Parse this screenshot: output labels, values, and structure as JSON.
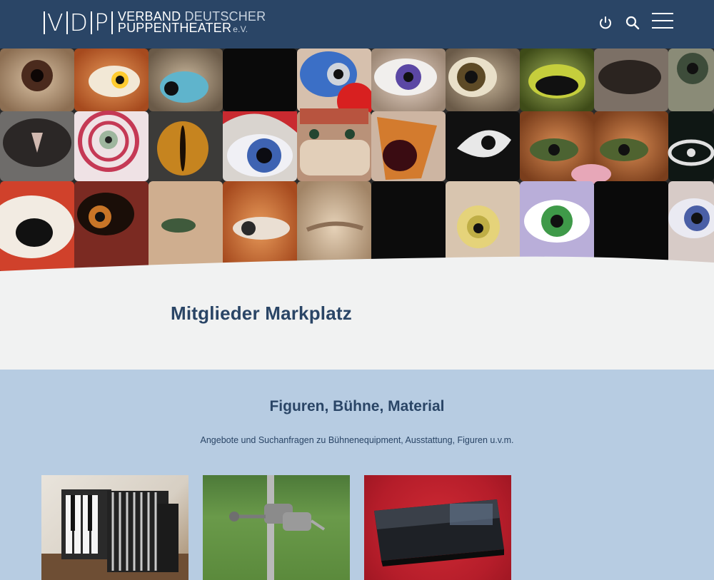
{
  "header": {
    "logo_mark": [
      "V",
      "D",
      "P"
    ],
    "logo_line1_a": "VERBAND",
    "logo_line1_b": "DEUTSCHER",
    "logo_line2": "PUPPENTHEATER",
    "logo_ev": "e.V.",
    "icons": [
      "power-icon",
      "search-icon",
      "menu-icon"
    ]
  },
  "hero": {
    "description_icons": "eyes-collage"
  },
  "page": {
    "title": "Mitglieder Markplatz"
  },
  "category": {
    "title": "Figuren, Bühne, Material",
    "subtitle": "Angebote und Suchanfragen zu Bühnenequipment, Ausstattung, Figuren u.v.m.",
    "cards": [
      {
        "name": "accordion-card"
      },
      {
        "name": "stand-clamp-card"
      },
      {
        "name": "boxed-product-card"
      }
    ]
  },
  "colors": {
    "header": "#2a4566",
    "title": "#2a4566",
    "section": "#b7cce2",
    "page_bg": "#f1f2f2"
  }
}
